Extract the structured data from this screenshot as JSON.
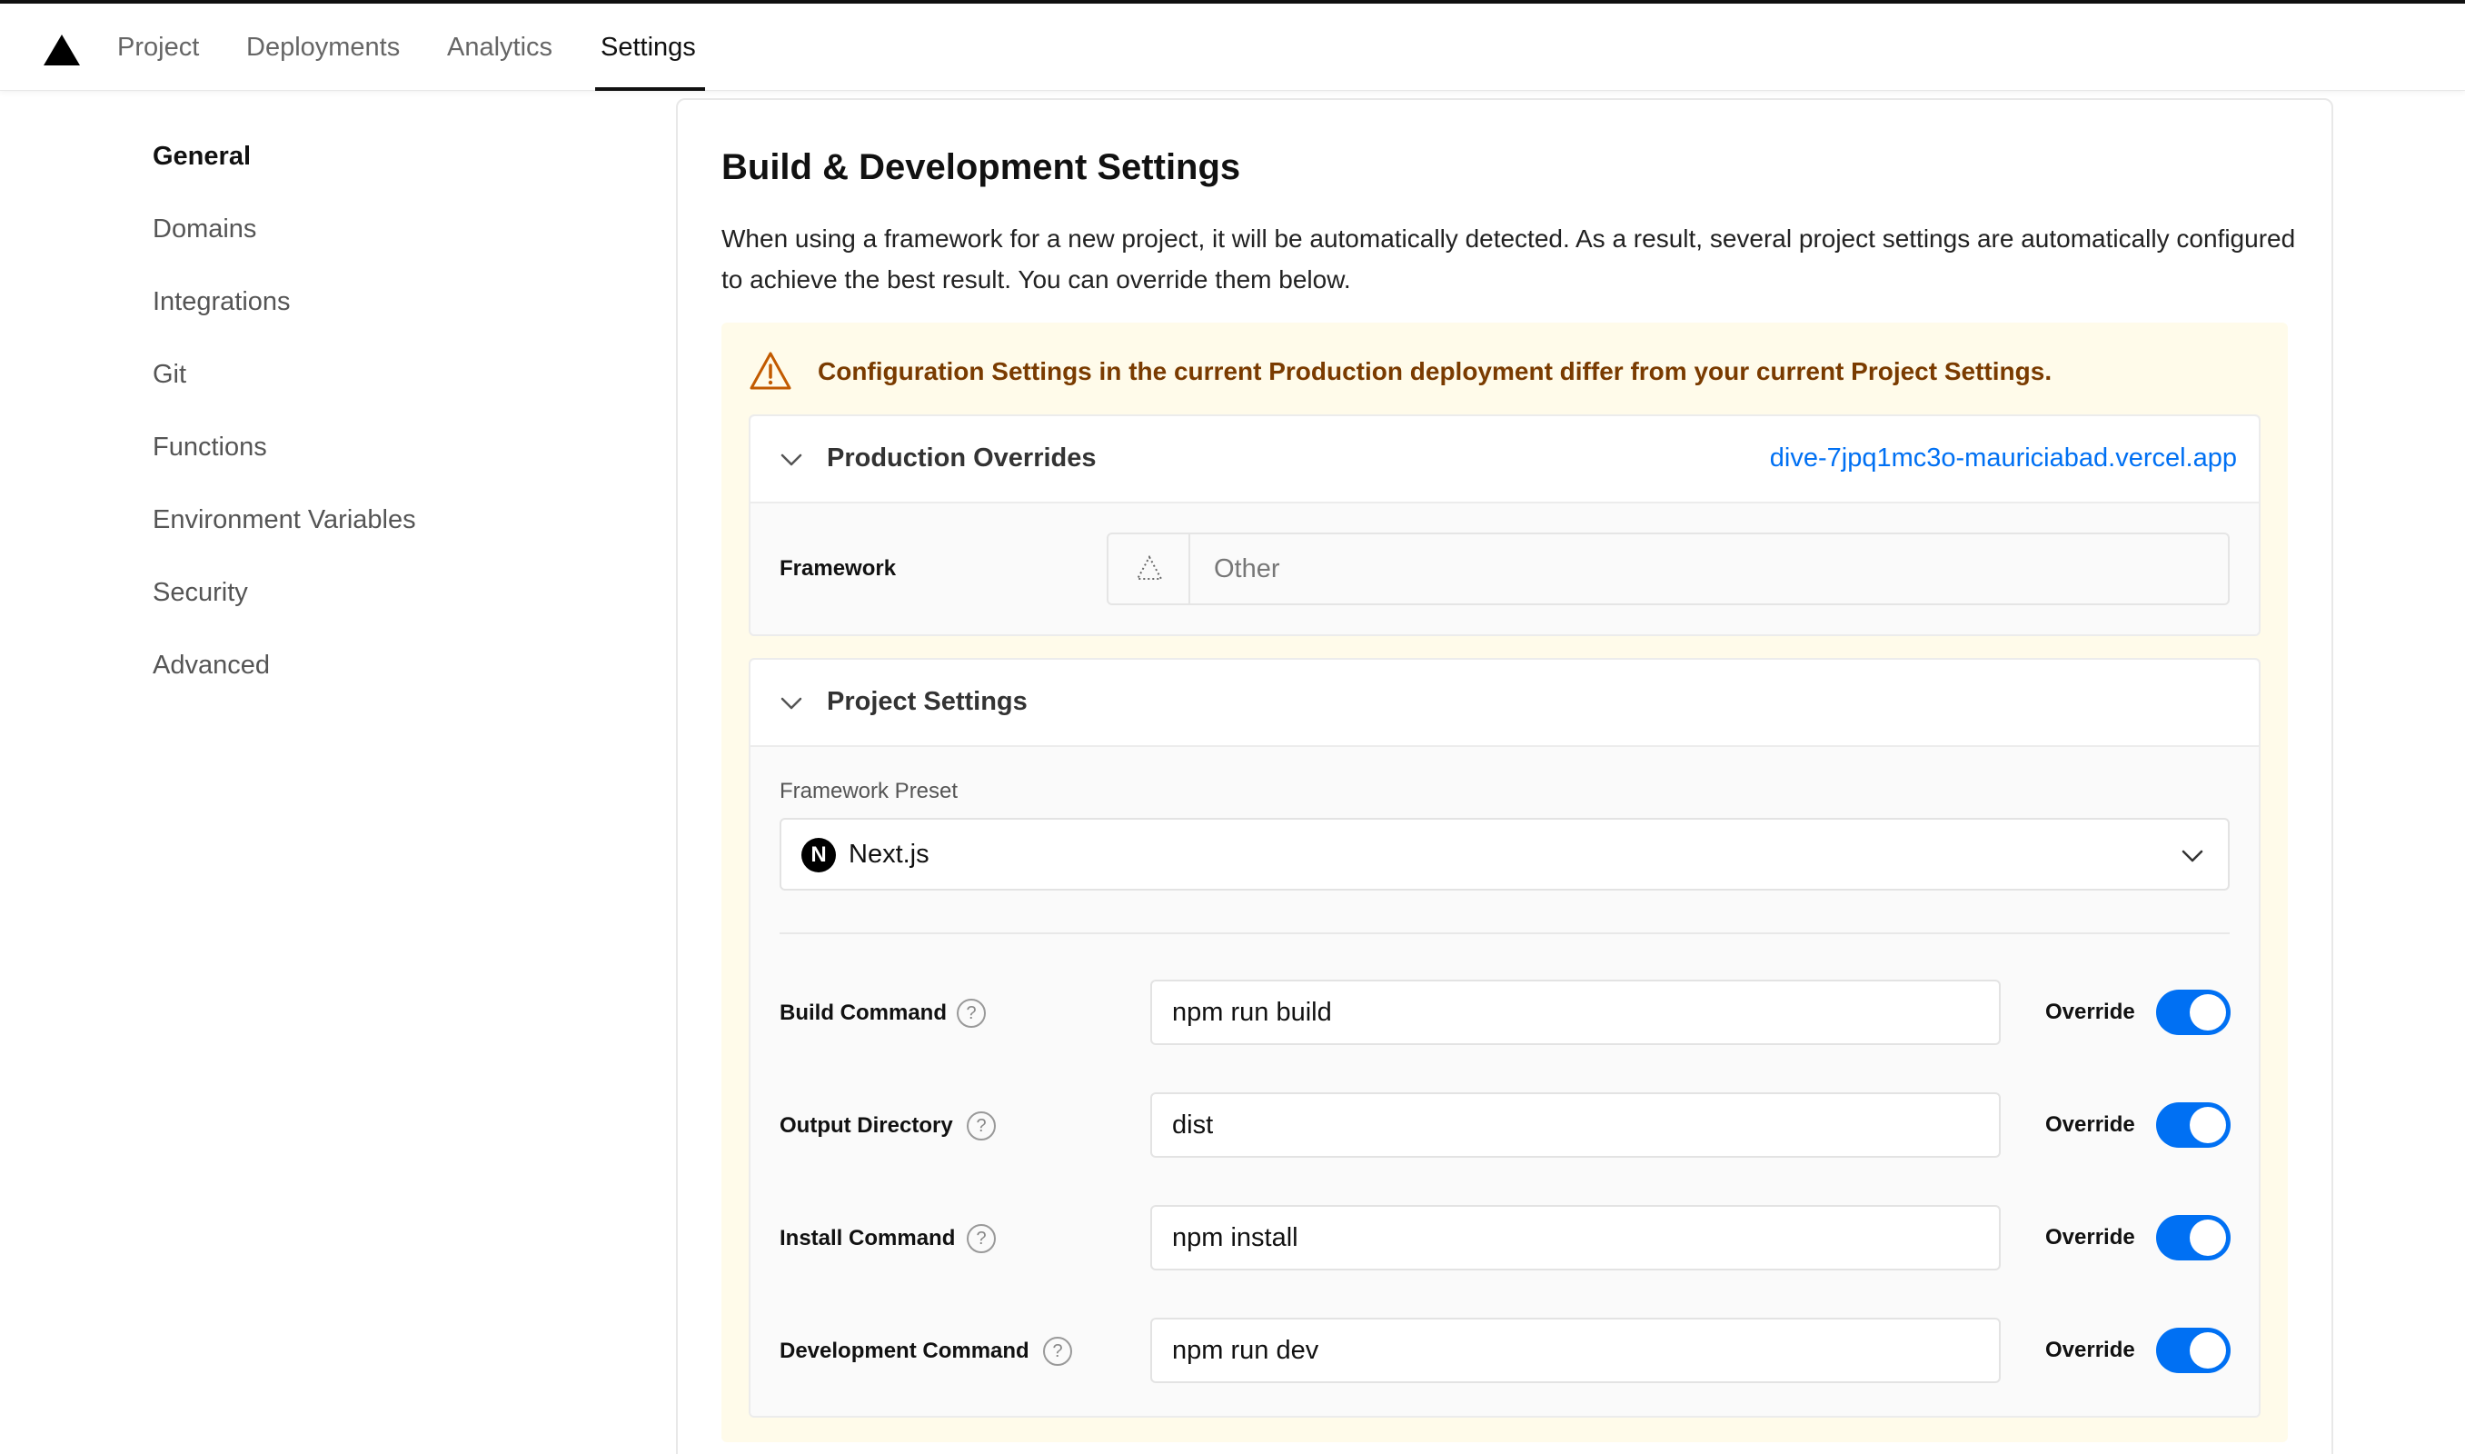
{
  "topnav": {
    "items": [
      {
        "label": "Project",
        "active": false
      },
      {
        "label": "Deployments",
        "active": false
      },
      {
        "label": "Analytics",
        "active": false
      },
      {
        "label": "Settings",
        "active": true
      }
    ]
  },
  "sidebar": {
    "items": [
      {
        "label": "General",
        "active": true
      },
      {
        "label": "Domains",
        "active": false
      },
      {
        "label": "Integrations",
        "active": false
      },
      {
        "label": "Git",
        "active": false
      },
      {
        "label": "Functions",
        "active": false
      },
      {
        "label": "Environment Variables",
        "active": false
      },
      {
        "label": "Security",
        "active": false
      },
      {
        "label": "Advanced",
        "active": false
      }
    ]
  },
  "main": {
    "title": "Build & Development Settings",
    "description": "When using a framework for a new project, it will be automatically detected. As a result, several project settings are automatically configured to achieve the best result. You can override them below.",
    "warning": "Configuration Settings in the current Production deployment differ from your current Project Settings.",
    "production_overrides": {
      "title": "Production Overrides",
      "deployment_link": "dive-7jpq1mc3o-mauriciabad.vercel.app",
      "framework_label": "Framework",
      "framework_value": "Other"
    },
    "project_settings": {
      "title": "Project Settings",
      "framework_preset_label": "Framework Preset",
      "framework_preset_value": "Next.js",
      "framework_preset_logo": "N",
      "commands": [
        {
          "label": "Build Command",
          "value": "npm run build",
          "override_label": "Override",
          "override": true
        },
        {
          "label": "Output Directory",
          "value": "dist",
          "override_label": "Override",
          "override": true
        },
        {
          "label": "Install Command",
          "value": "npm install",
          "override_label": "Override",
          "override": true
        },
        {
          "label": "Development Command",
          "value": "npm run dev",
          "override_label": "Override",
          "override": true
        }
      ]
    }
  },
  "icons": {
    "logo": "vercel-triangle-icon",
    "warning": "warning-triangle-icon",
    "chevron": "chevron-down-icon",
    "help": "question-circle-icon",
    "framework_other": "dotted-triangle-icon"
  },
  "colors": {
    "accent": "#0070f3",
    "warning_text": "#7a3b00",
    "warning_bg": "#fffbea",
    "warning_icon": "#c25a00"
  }
}
